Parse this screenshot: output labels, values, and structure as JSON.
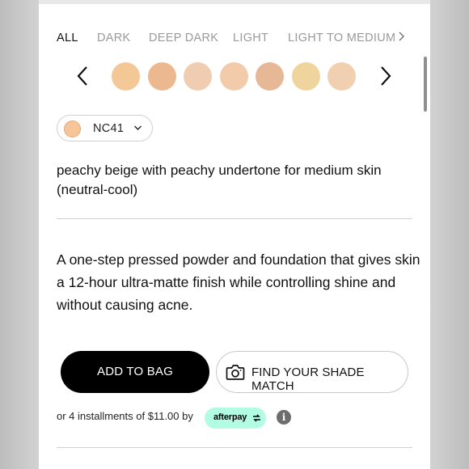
{
  "tabs": {
    "items": [
      {
        "label": "ALL",
        "active": true
      },
      {
        "label": "DARK",
        "active": false
      },
      {
        "label": "DEEP DARK",
        "active": false
      },
      {
        "label": "LIGHT",
        "active": false
      },
      {
        "label": "LIGHT TO MEDIUM",
        "active": false
      }
    ],
    "next_icon": "chevron-right-icon"
  },
  "swatches": {
    "prev_icon": "chevron-left-icon",
    "next_icon": "chevron-right-icon",
    "colors": [
      "#f3c796",
      "#ebb890",
      "#f0cdb0",
      "#f2cbaa",
      "#e6b896",
      "#f0d49d",
      "#f0d0b0"
    ]
  },
  "selected_shade": {
    "code": "NC41",
    "swatch_color": "#f7c698",
    "icon": "chevron-down-icon"
  },
  "shade_description": "peachy beige with peachy undertone for medium skin (neutral-cool)",
  "product_summary": "A one-step pressed powder and foundation that gives skin a 12-hour ultra-matte finish while controlling shine and without causing acne.",
  "actions": {
    "add_to_bag": "ADD TO BAG",
    "find_shade": "FIND YOUR SHADE MATCH",
    "find_shade_icon": "camera-icon"
  },
  "payment": {
    "installments_text": "or 4 installments of $11.00 by",
    "afterpay_label": "afterpay",
    "afterpay_color": "#b2fce4",
    "info_icon": "info-icon",
    "info_glyph": "i"
  }
}
